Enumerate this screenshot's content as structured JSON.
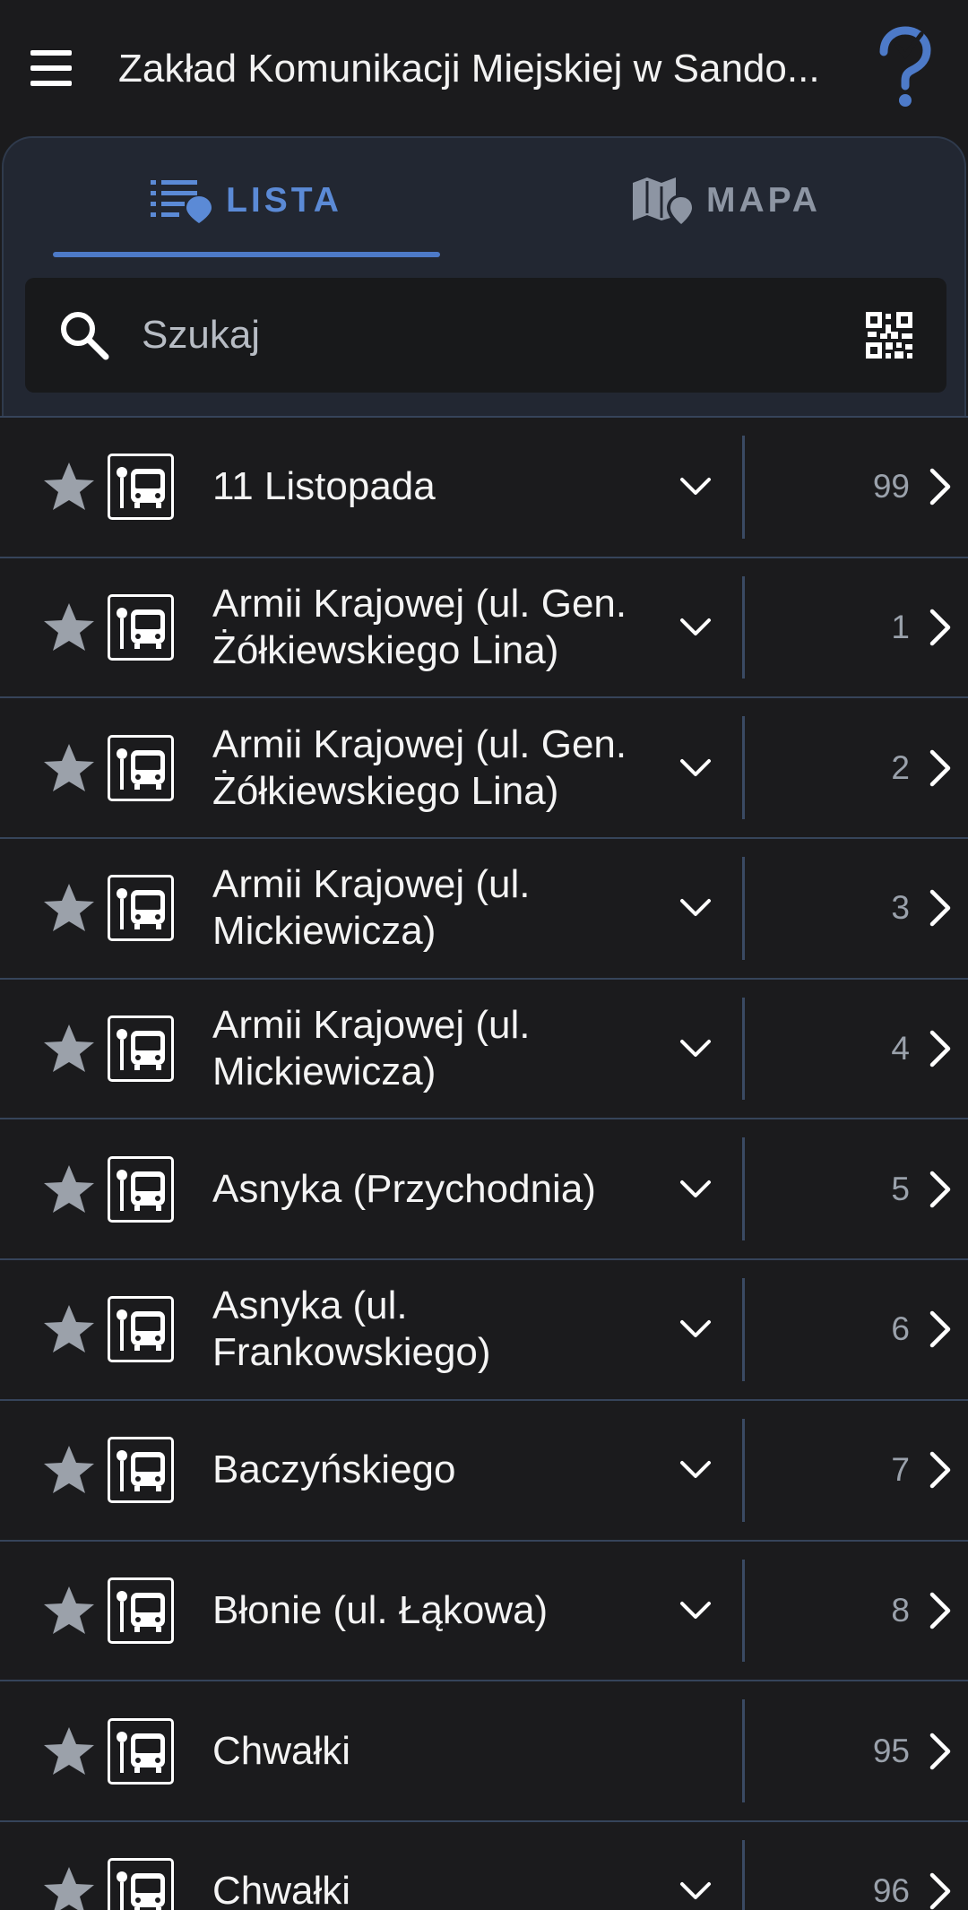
{
  "header": {
    "title": "Zakład Komunikacji Miejskiej w Sando...",
    "accent_color": "#4d7ac8"
  },
  "tabs": [
    {
      "label": "LISTA",
      "icon": "list-pin-icon",
      "active": true
    },
    {
      "label": "MAPA",
      "icon": "map-pin-icon",
      "active": false
    }
  ],
  "search": {
    "placeholder": "Szukaj",
    "value": ""
  },
  "stops": [
    {
      "name": "11 Listopada",
      "number": "99",
      "expandable": true
    },
    {
      "name": "Armii Krajowej (ul. Gen. Żółkiewskiego Lina)",
      "number": "1",
      "expandable": true
    },
    {
      "name": "Armii Krajowej (ul. Gen. Żółkiewskiego Lina)",
      "number": "2",
      "expandable": true
    },
    {
      "name": "Armii Krajowej (ul. Mickiewicza)",
      "number": "3",
      "expandable": true
    },
    {
      "name": "Armii Krajowej (ul. Mickiewicza)",
      "number": "4",
      "expandable": true
    },
    {
      "name": "Asnyka (Przychodnia)",
      "number": "5",
      "expandable": true
    },
    {
      "name": "Asnyka (ul. Frankowskiego)",
      "number": "6",
      "expandable": true
    },
    {
      "name": "Baczyńskiego",
      "number": "7",
      "expandable": true
    },
    {
      "name": "Błonie (ul. Łąkowa)",
      "number": "8",
      "expandable": true
    },
    {
      "name": "Chwałki",
      "number": "95",
      "expandable": false
    },
    {
      "name": "Chwałki",
      "number": "96",
      "expandable": true
    }
  ]
}
